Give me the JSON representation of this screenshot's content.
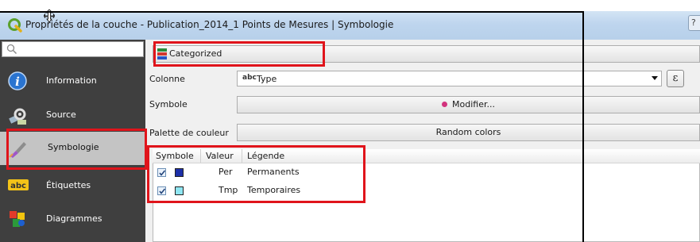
{
  "window": {
    "title": "Propriétés de la couche - Publication_2014_1 Points de Mesures | Symbologie",
    "expression_button_label": "ε"
  },
  "sidebar": {
    "search_placeholder": "",
    "items": [
      {
        "label": "Information",
        "icon": "info-icon"
      },
      {
        "label": "Source",
        "icon": "source-icon"
      },
      {
        "label": "Symbologie",
        "icon": "symbology-brush-icon"
      },
      {
        "label": "Étiquettes",
        "icon": "labels-abc-icon"
      },
      {
        "label": "Diagrammes",
        "icon": "diagrams-icon"
      }
    ],
    "selected_index": 2
  },
  "renderer": {
    "label": "Categorized",
    "icon": "categorized-icon"
  },
  "form": {
    "column_label": "Colonne",
    "column_value": "Type",
    "column_type_badge": "abc",
    "symbol_label": "Symbole",
    "modify_button": "Modifier...",
    "ramp_label": "Palette de couleur",
    "ramp_value": "Random colors"
  },
  "classes": {
    "headers": [
      "Symbole",
      "Valeur",
      "Légende"
    ],
    "rows": [
      {
        "checked": true,
        "color": "#1c2fa8",
        "value": "Per",
        "legend": "Permanents"
      },
      {
        "checked": true,
        "color": "#8fe6f2",
        "value": "Tmp",
        "legend": "Temporaires"
      }
    ]
  },
  "colors": {
    "highlight": "#e0141b",
    "sidebar_bg": "#3f3f3f",
    "modify_dot": "#d2337d"
  }
}
